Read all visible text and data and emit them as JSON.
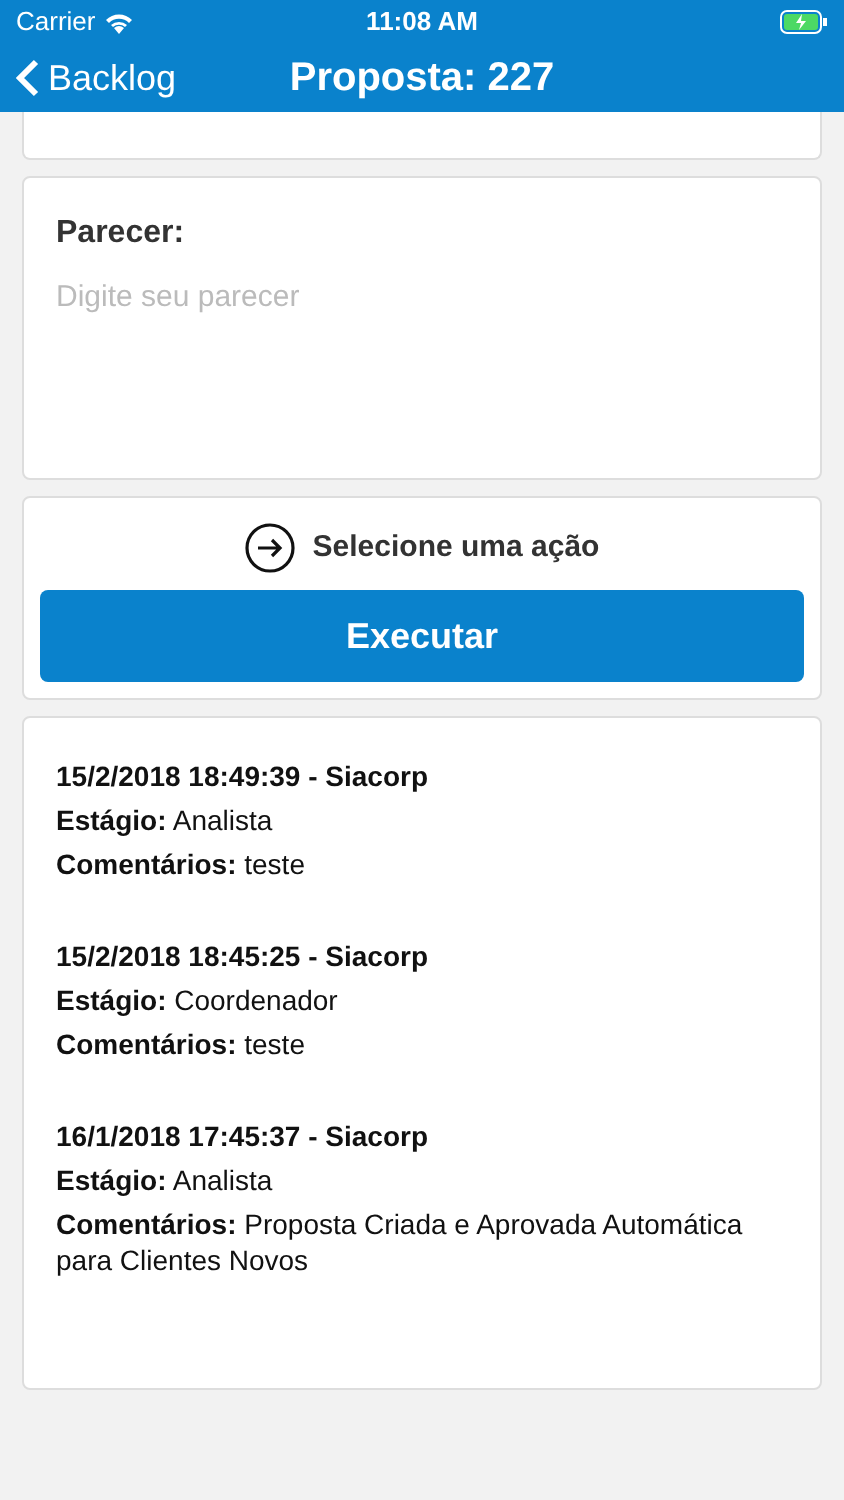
{
  "status_bar": {
    "carrier": "Carrier",
    "time": "11:08 AM",
    "charging": true
  },
  "nav": {
    "back": "Backlog",
    "title": "Proposta: 227"
  },
  "parecer": {
    "label": "Parecer:",
    "placeholder": "Digite seu parecer"
  },
  "action": {
    "prompt": "Selecione uma ação",
    "button": "Executar"
  },
  "history": [
    {
      "header": "15/2/2018 18:49:39 - Siacorp",
      "stage_label": "Estágio:",
      "stage": "Analista",
      "comments_label": "Comentários:",
      "comments": "teste"
    },
    {
      "header": "15/2/2018 18:45:25 - Siacorp",
      "stage_label": "Estágio:",
      "stage": "Coordenador",
      "comments_label": "Comentários:",
      "comments": "teste"
    },
    {
      "header": "16/1/2018 17:45:37 - Siacorp",
      "stage_label": "Estágio:",
      "stage": "Analista",
      "comments_label": "Comentários:",
      "comments": "Proposta Criada e Aprovada Automática para Clientes Novos"
    }
  ]
}
